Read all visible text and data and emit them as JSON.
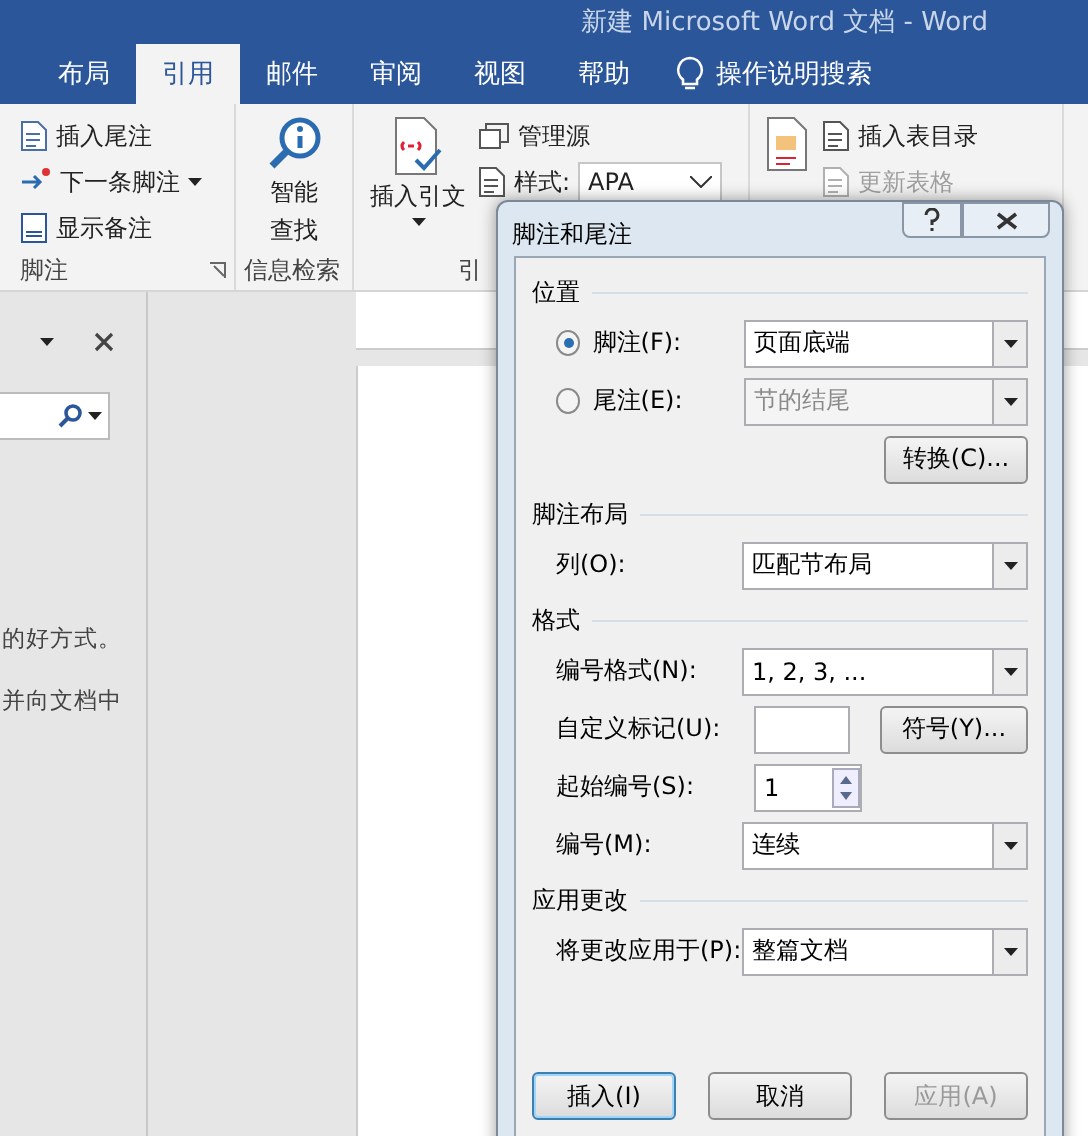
{
  "window": {
    "title": "新建 Microsoft Word 文档  -  Word"
  },
  "tabs": [
    {
      "label": "布局",
      "selected": false
    },
    {
      "label": "引用",
      "selected": true
    },
    {
      "label": "邮件",
      "selected": false
    },
    {
      "label": "审阅",
      "selected": false
    },
    {
      "label": "视图",
      "selected": false
    },
    {
      "label": "帮助",
      "selected": false
    }
  ],
  "tell_me": "操作说明搜索",
  "ribbon": {
    "footnotes": {
      "items": [
        {
          "label": "插入尾注",
          "dropdown": false
        },
        {
          "label": "下一条脚注",
          "dropdown": true
        },
        {
          "label": "显示备注",
          "dropdown": false
        }
      ],
      "label": "脚注"
    },
    "research": {
      "lines": [
        "智能",
        "查找"
      ],
      "label": "信息检索"
    },
    "citations": {
      "big": "插入引文",
      "manage": "管理源",
      "style_label": "样式:",
      "style_value": "APA",
      "label": "引"
    },
    "captions": {
      "items": [
        {
          "label": "插入表目录",
          "disabled": false
        },
        {
          "label": "更新表格",
          "disabled": true
        }
      ]
    }
  },
  "task_pane": {
    "texts": [
      "的好方式。",
      "并向文档中"
    ]
  },
  "dialog": {
    "title": "脚注和尾注",
    "sections": [
      {
        "heading": "位置",
        "rows": [
          {
            "kind": "radio",
            "label": "脚注(F):",
            "selected": true,
            "value": "页面底端",
            "disabled": false
          },
          {
            "kind": "radio",
            "label": "尾注(E):",
            "selected": false,
            "value": "节的结尾",
            "disabled": true
          },
          {
            "kind": "button",
            "value": "转换(C)..."
          }
        ]
      },
      {
        "heading": "脚注布局",
        "rows": [
          {
            "kind": "combo",
            "label": "列(O):",
            "value": "匹配节布局"
          }
        ]
      },
      {
        "heading": "格式",
        "rows": [
          {
            "kind": "combo",
            "label": "编号格式(N):",
            "value": "1, 2, 3, ..."
          },
          {
            "kind": "text",
            "label": "自定义标记(U):",
            "button": "符号(Y)..."
          },
          {
            "kind": "spin",
            "label": "起始编号(S):",
            "value": "1"
          },
          {
            "kind": "combo",
            "label": "编号(M):",
            "value": "连续"
          }
        ]
      },
      {
        "heading": "应用更改",
        "rows": [
          {
            "kind": "combo",
            "label": "将更改应用于(P):",
            "value": "整篇文档"
          }
        ]
      }
    ],
    "buttons": [
      {
        "label": "插入(I)",
        "default": true,
        "disabled": false
      },
      {
        "label": "取消",
        "default": false,
        "disabled": false
      },
      {
        "label": "应用(A)",
        "default": false,
        "disabled": true
      }
    ]
  }
}
